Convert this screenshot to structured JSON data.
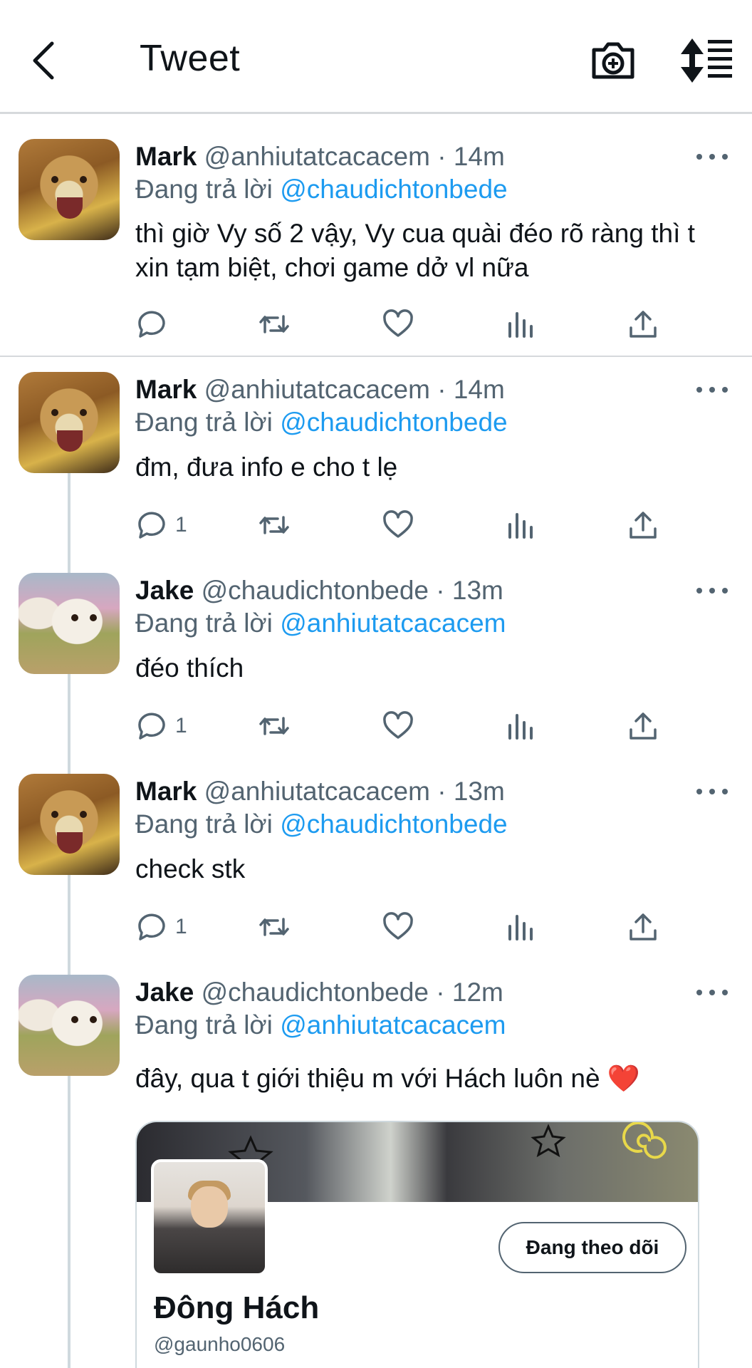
{
  "header": {
    "title": "Tweet",
    "back_icon": "back-arrow-icon",
    "camera_icon": "camera-add-icon",
    "sort_icon": "sort-icon"
  },
  "tweets": [
    {
      "name": "Mark",
      "handle": "@anhiutatcacacem",
      "time": "· 14m",
      "reply_prefix": "Đang trả lời",
      "reply_to": "@chaudichtonbede",
      "text": "thì giờ Vy số 2 vậy, Vy cua quài đéo rõ ràng thì t xin tạm biệt, chơi game dở vl nữa",
      "reply_count": ""
    },
    {
      "name": "Mark",
      "handle": "@anhiutatcacacem",
      "time": "· 14m",
      "reply_prefix": "Đang trả lời",
      "reply_to": "@chaudichtonbede",
      "text": "đm, đưa info e cho t lẹ",
      "reply_count": "1"
    },
    {
      "name": "Jake",
      "handle": "@chaudichtonbede",
      "time": "· 13m",
      "reply_prefix": "Đang trả lời",
      "reply_to": "@anhiutatcacacem",
      "text": "đéo thích",
      "reply_count": "1"
    },
    {
      "name": "Mark",
      "handle": "@anhiutatcacacem",
      "time": "· 13m",
      "reply_prefix": "Đang trả lời",
      "reply_to": "@chaudichtonbede",
      "text": "check stk",
      "reply_count": "1"
    },
    {
      "name": "Jake",
      "handle": "@chaudichtonbede",
      "time": "· 12m",
      "reply_prefix": "Đang trả lời",
      "reply_to": "@anhiutatcacacem",
      "text": "đây, qua t giới thiệu m với Hách luôn nè",
      "emoji": "❤️"
    }
  ],
  "profile_card": {
    "name": "Đông Hách",
    "handle": "@gaunho0606",
    "follow_label": "Đang theo dõi"
  },
  "colors": {
    "accent": "#1d9bf0",
    "secondary_text": "#536471",
    "divider": "#d6d9dc"
  }
}
